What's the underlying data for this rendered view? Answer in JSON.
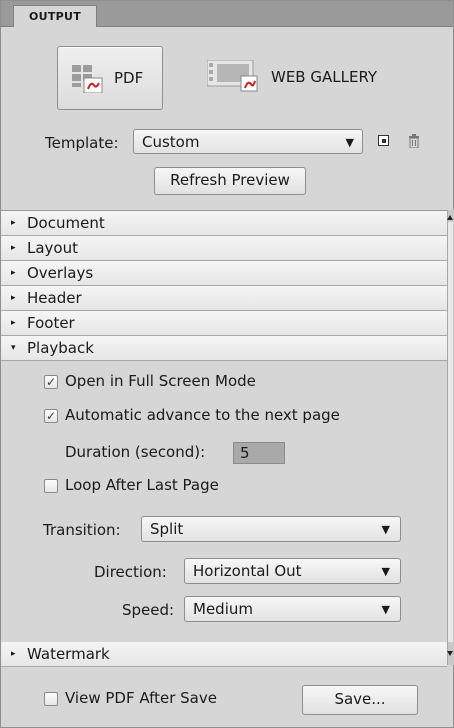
{
  "tab": {
    "label": "OUTPUT"
  },
  "modes": {
    "pdf_label": "PDF",
    "web_label": "WEB GALLERY"
  },
  "template": {
    "label": "Template:",
    "value": "Custom",
    "refresh_label": "Refresh Preview"
  },
  "sections": {
    "document": "Document",
    "layout": "Layout",
    "overlays": "Overlays",
    "header": "Header",
    "footer": "Footer",
    "playback": "Playback",
    "watermark": "Watermark"
  },
  "playback": {
    "full_screen_label": "Open in Full Screen Mode",
    "full_screen_checked": true,
    "auto_advance_label": "Automatic advance to the next page",
    "auto_advance_checked": true,
    "duration_label": "Duration (second):",
    "duration_value": "5",
    "loop_label": "Loop After Last Page",
    "loop_checked": false,
    "transition_label": "Transition:",
    "transition_value": "Split",
    "direction_label": "Direction:",
    "direction_value": "Horizontal Out",
    "speed_label": "Speed:",
    "speed_value": "Medium"
  },
  "footer": {
    "view_pdf_label": "View PDF After Save",
    "view_pdf_checked": false,
    "save_label": "Save..."
  },
  "icons": {
    "collapsed": "▸",
    "expanded": "▾",
    "dropdown": "▼",
    "check": "✓"
  }
}
